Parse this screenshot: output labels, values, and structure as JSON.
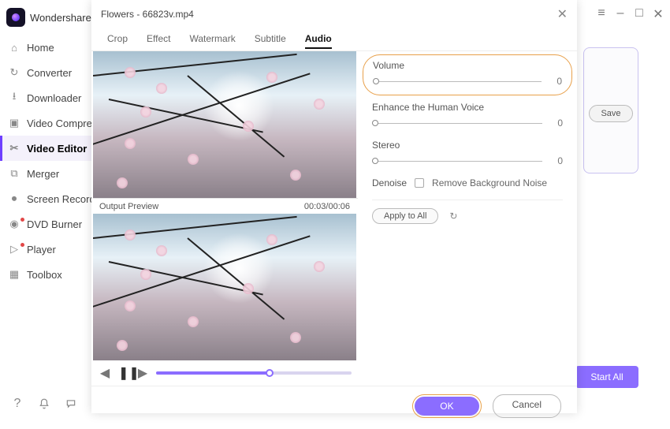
{
  "app": {
    "name": "Wondershare"
  },
  "window": {
    "hamburger": "≡",
    "min": "–",
    "max": "□",
    "close": "✕"
  },
  "sidebar": {
    "items": [
      {
        "label": "Home",
        "icon": "home"
      },
      {
        "label": "Converter",
        "icon": "convert"
      },
      {
        "label": "Downloader",
        "icon": "download"
      },
      {
        "label": "Video Compre",
        "icon": "compress"
      },
      {
        "label": "Video Editor",
        "icon": "scissors",
        "active": true
      },
      {
        "label": "Merger",
        "icon": "merge"
      },
      {
        "label": "Screen Recorde",
        "icon": "record"
      },
      {
        "label": "DVD Burner",
        "icon": "dvd"
      },
      {
        "label": "Player",
        "icon": "play"
      },
      {
        "label": "Toolbox",
        "icon": "toolbox"
      }
    ]
  },
  "right": {
    "save_label": "Save",
    "start_all_label": "Start All"
  },
  "dialog": {
    "title": "Flowers - 66823v.mp4",
    "tabs": [
      {
        "label": "Crop"
      },
      {
        "label": "Effect"
      },
      {
        "label": "Watermark"
      },
      {
        "label": "Subtitle"
      },
      {
        "label": "Audio",
        "active": true
      }
    ],
    "output_label": "Output Preview",
    "time": "00:03/00:06",
    "controls": {
      "back": "◀",
      "pause": "❚❚",
      "fwd": "▶"
    },
    "audio": {
      "volume": {
        "label": "Volume",
        "value": "0"
      },
      "enhance": {
        "label": "Enhance the Human Voice",
        "value": "0"
      },
      "stereo": {
        "label": "Stereo",
        "value": "0"
      },
      "denoise_label": "Denoise",
      "denoise_option": "Remove Background Noise",
      "apply_label": "Apply to All",
      "reset_icon": "↻"
    },
    "footer": {
      "ok": "OK",
      "cancel": "Cancel"
    }
  },
  "footer_icons": {
    "help": "?",
    "bell": "🔔",
    "chat": "💬"
  }
}
